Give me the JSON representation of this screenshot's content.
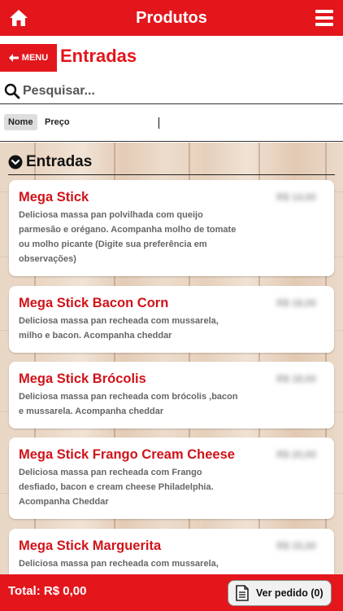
{
  "header": {
    "title": "Produtos",
    "home_icon": "home-icon",
    "menu_icon": "hamburger-icon"
  },
  "subheader": {
    "back_label": "MENU",
    "section_title": "Entradas"
  },
  "search": {
    "placeholder": "Pesquisar...",
    "value": ""
  },
  "sort": {
    "name_label": "Nome",
    "price_label": "Preço"
  },
  "category": {
    "title": "Entradas"
  },
  "items": [
    {
      "name": "Mega Stick",
      "description": "Deliciosa massa pan polvilhada com queijo parmesão e orégano. Acompanha molho de tomate ou molho picante (Digite sua preferência em observações)",
      "price": "R$ 14,00"
    },
    {
      "name": "Mega Stick Bacon Corn",
      "description": "Deliciosa massa pan recheada com mussarela, milho e bacon. Acompanha cheddar",
      "price": "R$ 18,00"
    },
    {
      "name": "Mega Stick Brócolis",
      "description": "Deliciosa massa pan recheada com brócolis ,bacon e mussarela. Acompanha cheddar",
      "price": "R$ 18,00"
    },
    {
      "name": "Mega Stick Frango Cream Cheese",
      "description": "Deliciosa massa pan recheada com Frango desfiado, bacon e cream cheese Philadelphia. Acompanha Cheddar",
      "price": "R$ 20,00"
    },
    {
      "name": "Mega Stick Marguerita",
      "description": "Deliciosa massa pan recheada com mussarela, tomate e manjericão. Acompanha cheddar",
      "price": "R$ 15,00"
    }
  ],
  "footer": {
    "total_label": "Total: R$ 0,00",
    "order_button_label": "Ver pedido (0)"
  },
  "colors": {
    "brand_red": "#e3161c",
    "item_name_red": "#d0131a"
  }
}
